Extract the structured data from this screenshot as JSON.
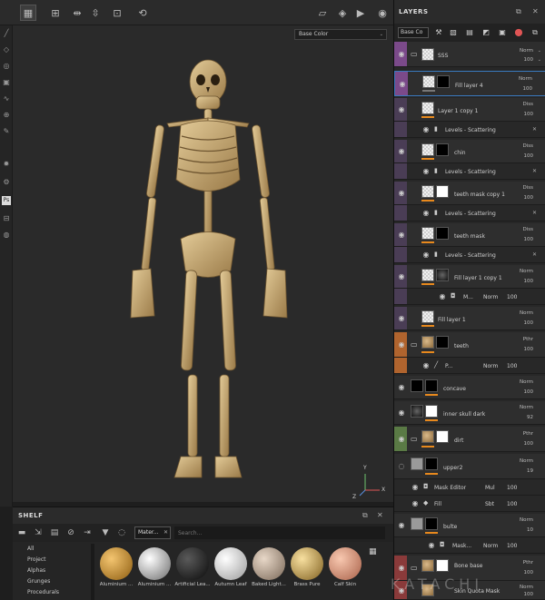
{
  "viewport": {
    "channel": "Base Color",
    "axis_x": "X",
    "axis_y": "Y",
    "axis_z": "Z"
  },
  "shelf": {
    "title": "SHELF",
    "filter_chip": "Mater...",
    "search_placeholder": "Search...",
    "categories": [
      "All",
      "Project",
      "Alphas",
      "Grunges",
      "Procedurals"
    ],
    "materials": [
      {
        "label": "Aluminium ...",
        "color": "#c8902a"
      },
      {
        "label": "Aluminium ...",
        "color": "#bfbfbf"
      },
      {
        "label": "Artificial Lea...",
        "color": "#2a2a2a"
      },
      {
        "label": "Autumn Leaf",
        "color": "#d8d8d8"
      },
      {
        "label": "Baked Light...",
        "color": "#c7b5a4"
      },
      {
        "label": "Brass Pure",
        "color": "#d0b063"
      },
      {
        "label": "Calf Skin",
        "color": "#e0a08a"
      }
    ]
  },
  "layers": {
    "title": "LAYERS",
    "channel_select": "Base Co",
    "items": [
      {
        "name": "SSS",
        "blend": "Norm",
        "opacity": "100",
        "group": true
      },
      {
        "name": "Fill layer 4",
        "blend": "Norm",
        "opacity": "100"
      },
      {
        "name": "Layer 1 copy 1",
        "blend": "Diss",
        "opacity": "100"
      },
      {
        "name": "Levels - Scattering",
        "sub": true
      },
      {
        "name": "chin",
        "blend": "Diss",
        "opacity": "100"
      },
      {
        "name": "Levels - Scattering",
        "sub": true
      },
      {
        "name": "teeth mask copy 1",
        "blend": "Diss",
        "opacity": "100"
      },
      {
        "name": "Levels - Scattering",
        "sub": true
      },
      {
        "name": "teeth mask",
        "blend": "Diss",
        "opacity": "100"
      },
      {
        "name": "Levels - Scattering",
        "sub": true
      },
      {
        "name": "Fill layer 1 copy 1",
        "blend": "Norm",
        "opacity": "100"
      },
      {
        "name": "M...",
        "blend": "Norm",
        "opacity": "100",
        "sub": true
      },
      {
        "name": "Fill layer 1",
        "blend": "Norm",
        "opacity": "100"
      },
      {
        "name": "teeth",
        "blend": "Pthr",
        "opacity": "100",
        "group": true
      },
      {
        "name": "P...",
        "blend": "Norm",
        "opacity": "100",
        "sub": true
      },
      {
        "name": "concave",
        "blend": "Norm",
        "opacity": "100"
      },
      {
        "name": "inner skull dark",
        "blend": "Norm",
        "opacity": "92"
      },
      {
        "name": "dirt",
        "blend": "Pthr",
        "opacity": "100",
        "group": true
      },
      {
        "name": "upper2",
        "blend": "Norm",
        "opacity": "19"
      },
      {
        "name": "Mask Editor",
        "blend": "Mul",
        "opacity": "100",
        "sub": true
      },
      {
        "name": "Fill",
        "blend": "Sbt",
        "opacity": "100",
        "sub": true
      },
      {
        "name": "bulte",
        "blend": "Norm",
        "opacity": "10"
      },
      {
        "name": "Mask...",
        "blend": "Norm",
        "opacity": "100",
        "sub": true
      },
      {
        "name": "Bone base",
        "blend": "Pthr",
        "opacity": "100",
        "group": true
      },
      {
        "name": "Skin Quota Mask",
        "blend": "Norm",
        "opacity": "100"
      }
    ]
  },
  "watermark": "KATACHI",
  "colors": {
    "accent": "#e8891d",
    "selection": "#3a7ac0"
  }
}
